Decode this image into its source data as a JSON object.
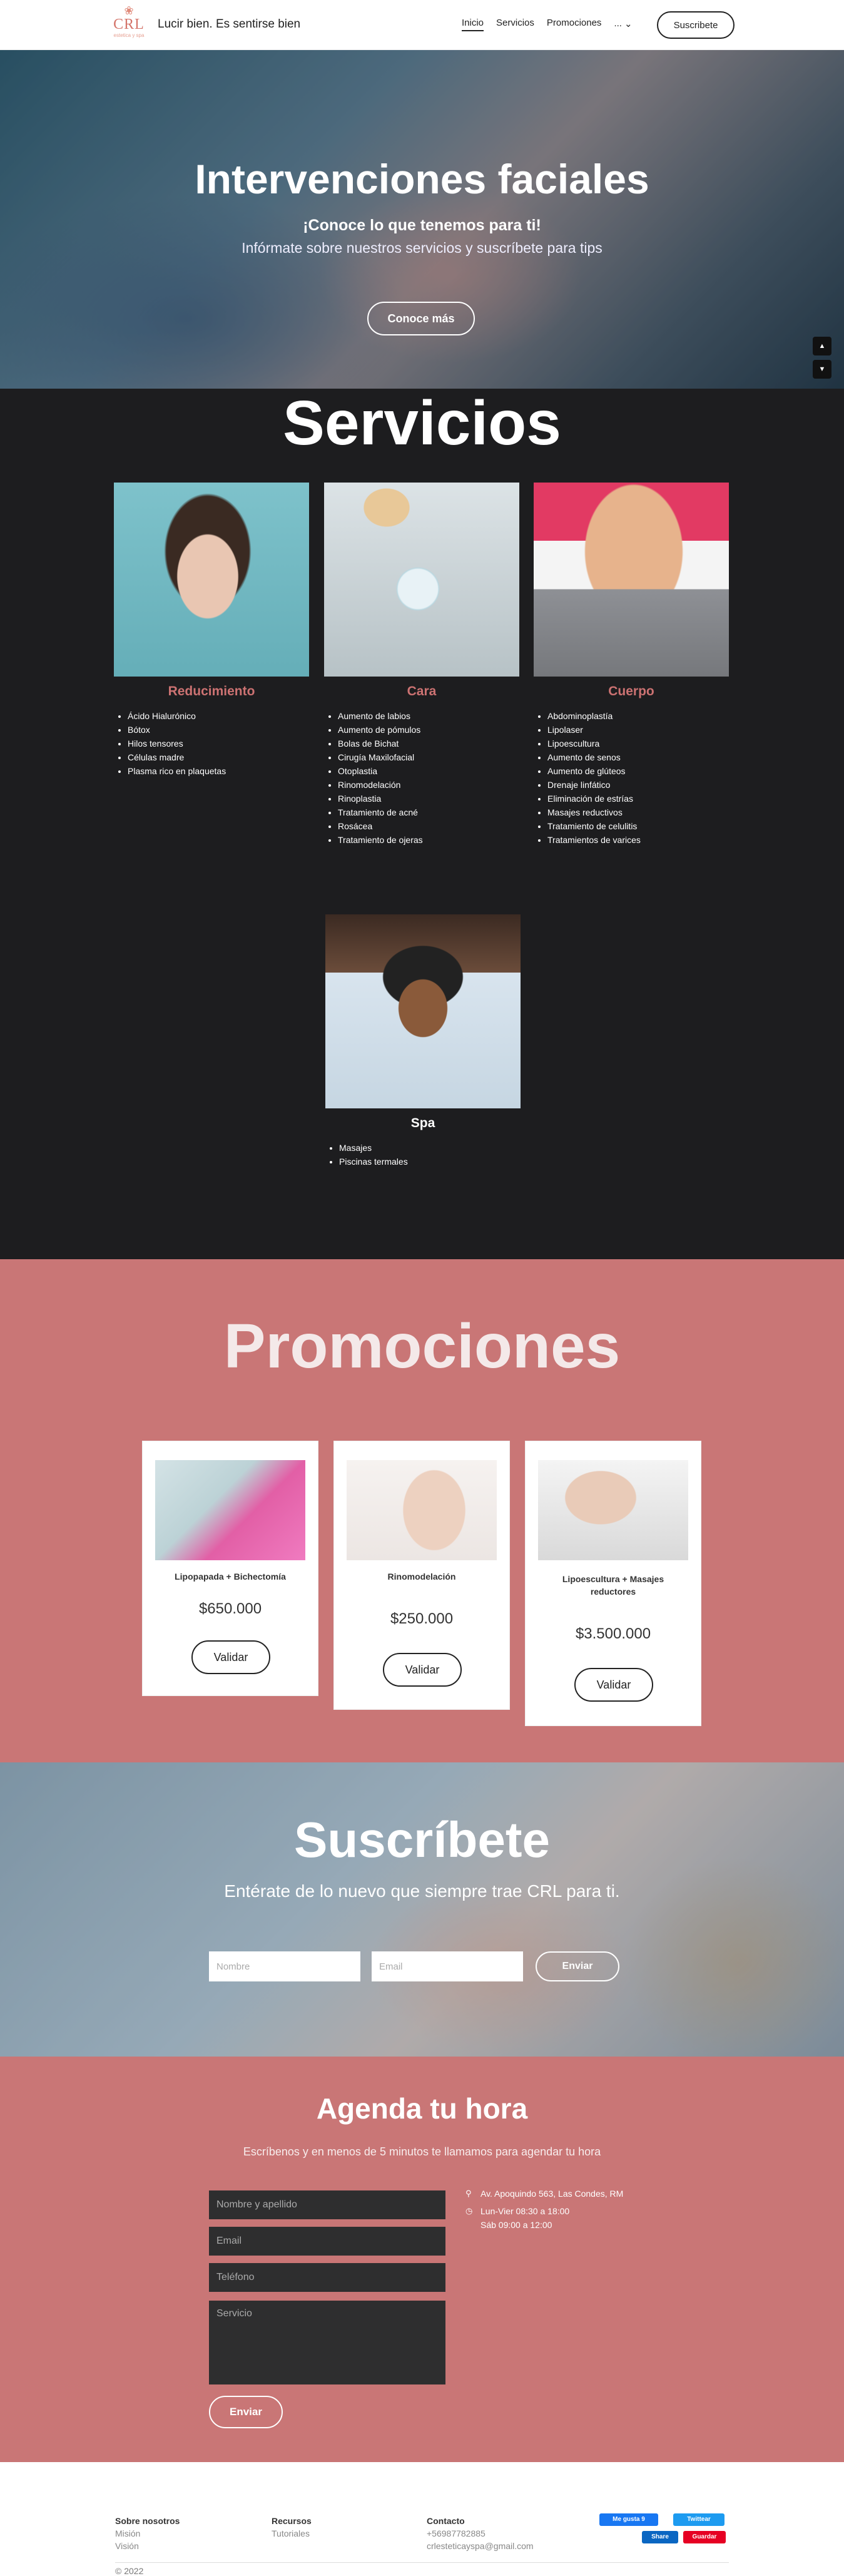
{
  "navbar": {
    "brand_mark": "CRL",
    "brand_sub": "estetica y spa",
    "slogan": "Lucir bien. Es sentirse bien",
    "links": [
      "Inicio",
      "Servicios",
      "Promociones",
      "..."
    ],
    "subscribe_label": "Suscribete"
  },
  "hero": {
    "title": "Intervenciones faciales",
    "subtitle": "¡Conoce lo que tenemos para ti!",
    "subtitle2": "Infórmate sobre nuestros servicios y suscríbete para tips",
    "button": "Conoce más"
  },
  "servicios": {
    "title": "Servicios",
    "items": [
      {
        "name": "Reducimiento",
        "list": [
          "Ácido Hialurónico",
          "Bótox",
          "Hilos tensores",
          "Células madre",
          "Plasma rico en plaquetas"
        ]
      },
      {
        "name": "Cara",
        "list": [
          "Aumento de labios",
          "Aumento de pómulos",
          "Bolas de Bichat",
          "Cirugía Maxilofacial",
          "Otoplastia",
          "Rinomodelación",
          "Rinoplastia",
          "Tratamiento de acné",
          "Rosácea",
          "Tratamiento de ojeras"
        ]
      },
      {
        "name": "Cuerpo",
        "list": [
          "Abdominoplastía",
          "Lipolaser",
          "Lipoescultura",
          "Aumento de senos",
          "Aumento de glúteos",
          "Drenaje linfático",
          "Eliminación de estrías",
          "Masajes reductivos",
          "Tratamiento de celulitis",
          "Tratamientos de varices"
        ]
      },
      {
        "name": "Spa",
        "list": [
          "Masajes",
          "Piscinas termales"
        ]
      }
    ]
  },
  "promociones": {
    "title": "Promociones",
    "cards": [
      {
        "name": "Lipopapada + Bichectomía",
        "price": "$650.000",
        "button": "Validar"
      },
      {
        "name": "Rinomodelación",
        "price": "$250.000",
        "button": "Validar"
      },
      {
        "name": "Lipoescultura + Masajes reductores",
        "price": "$3.500.000",
        "button": "Validar"
      }
    ]
  },
  "suscribete": {
    "title": "Suscríbete",
    "subtitle": "Entérate de lo nuevo que siempre trae CRL para ti.",
    "name_placeholder": "Nombre",
    "email_placeholder": "Email",
    "button": "Enviar"
  },
  "agenda": {
    "title": "Agenda tu hora",
    "subtitle": "Escríbenos y en menos de 5 minutos te llamamos para agendar tu hora",
    "name_placeholder": "Nombre y apellido",
    "email_placeholder": "Email",
    "phone_placeholder": "Teléfono",
    "service_placeholder": "Servicio",
    "button": "Enviar",
    "address": "Av. Apoquindo 563, Las Condes, RM",
    "hours_1": "Lun-Vier 08:30 a 18:00",
    "hours_2": "Sáb 09:00 a 12:00"
  },
  "footer": {
    "about": {
      "head": "Sobre nosotros",
      "items": [
        "Misión",
        "Visión"
      ]
    },
    "resources": {
      "head": "Recursos",
      "items": [
        "Tutoriales"
      ]
    },
    "contact": {
      "head": "Contacto",
      "items": [
        "+56987782885",
        "crlesteticayspa@gmail.com"
      ]
    },
    "social": {
      "facebook": "Me gusta 9",
      "twitter": "Twittear",
      "linkedin": "Share",
      "pinterest": "Guardar"
    },
    "copyright": "© 2022"
  },
  "colors": {
    "accent": "#c97676",
    "dark": "#1d1d1f",
    "salmon": "#cc7272"
  }
}
